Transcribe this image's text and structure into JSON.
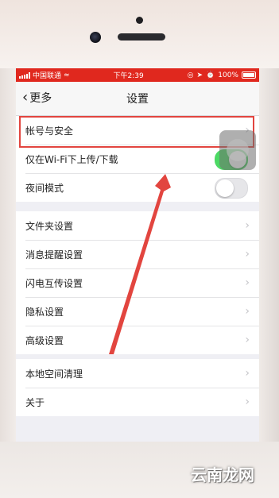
{
  "statusbar": {
    "carrier": "中国联通",
    "time": "下午2:39",
    "battery": "100%"
  },
  "nav": {
    "back_label": "更多",
    "title": "设置"
  },
  "sections": [
    {
      "items": [
        {
          "label": "帐号与安全",
          "control": "arrow"
        },
        {
          "label": "仅在Wi-Fi下上传/下载",
          "control": "toggle",
          "on": true
        },
        {
          "label": "夜间模式",
          "control": "toggle",
          "on": false
        }
      ]
    },
    {
      "items": [
        {
          "label": "文件夹设置",
          "control": "arrow"
        },
        {
          "label": "消息提醒设置",
          "control": "arrow"
        },
        {
          "label": "闪电互传设置",
          "control": "arrow"
        },
        {
          "label": "隐私设置",
          "control": "arrow"
        },
        {
          "label": "高级设置",
          "control": "arrow"
        }
      ]
    },
    {
      "items": [
        {
          "label": "本地空间清理",
          "control": "arrow"
        },
        {
          "label": "关于",
          "control": "arrow"
        }
      ]
    }
  ],
  "annotation": {
    "highlight_color": "#e2453f",
    "arrow_color": "#e2453f"
  },
  "watermark": "云南龙网",
  "colors": {
    "statusbar": "#e0281e",
    "toggle_on": "#4cd964"
  }
}
